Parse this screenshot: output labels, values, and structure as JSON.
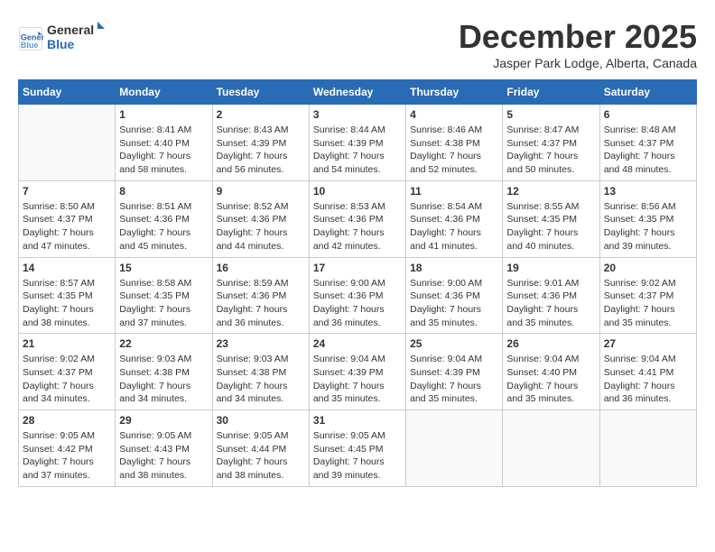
{
  "header": {
    "logo_line1": "General",
    "logo_line2": "Blue",
    "month_title": "December 2025",
    "location": "Jasper Park Lodge, Alberta, Canada"
  },
  "days_of_week": [
    "Sunday",
    "Monday",
    "Tuesday",
    "Wednesday",
    "Thursday",
    "Friday",
    "Saturday"
  ],
  "weeks": [
    [
      {
        "day": "",
        "info": ""
      },
      {
        "day": "1",
        "info": "Sunrise: 8:41 AM\nSunset: 4:40 PM\nDaylight: 7 hours\nand 58 minutes."
      },
      {
        "day": "2",
        "info": "Sunrise: 8:43 AM\nSunset: 4:39 PM\nDaylight: 7 hours\nand 56 minutes."
      },
      {
        "day": "3",
        "info": "Sunrise: 8:44 AM\nSunset: 4:39 PM\nDaylight: 7 hours\nand 54 minutes."
      },
      {
        "day": "4",
        "info": "Sunrise: 8:46 AM\nSunset: 4:38 PM\nDaylight: 7 hours\nand 52 minutes."
      },
      {
        "day": "5",
        "info": "Sunrise: 8:47 AM\nSunset: 4:37 PM\nDaylight: 7 hours\nand 50 minutes."
      },
      {
        "day": "6",
        "info": "Sunrise: 8:48 AM\nSunset: 4:37 PM\nDaylight: 7 hours\nand 48 minutes."
      }
    ],
    [
      {
        "day": "7",
        "info": "Sunrise: 8:50 AM\nSunset: 4:37 PM\nDaylight: 7 hours\nand 47 minutes."
      },
      {
        "day": "8",
        "info": "Sunrise: 8:51 AM\nSunset: 4:36 PM\nDaylight: 7 hours\nand 45 minutes."
      },
      {
        "day": "9",
        "info": "Sunrise: 8:52 AM\nSunset: 4:36 PM\nDaylight: 7 hours\nand 44 minutes."
      },
      {
        "day": "10",
        "info": "Sunrise: 8:53 AM\nSunset: 4:36 PM\nDaylight: 7 hours\nand 42 minutes."
      },
      {
        "day": "11",
        "info": "Sunrise: 8:54 AM\nSunset: 4:36 PM\nDaylight: 7 hours\nand 41 minutes."
      },
      {
        "day": "12",
        "info": "Sunrise: 8:55 AM\nSunset: 4:35 PM\nDaylight: 7 hours\nand 40 minutes."
      },
      {
        "day": "13",
        "info": "Sunrise: 8:56 AM\nSunset: 4:35 PM\nDaylight: 7 hours\nand 39 minutes."
      }
    ],
    [
      {
        "day": "14",
        "info": "Sunrise: 8:57 AM\nSunset: 4:35 PM\nDaylight: 7 hours\nand 38 minutes."
      },
      {
        "day": "15",
        "info": "Sunrise: 8:58 AM\nSunset: 4:35 PM\nDaylight: 7 hours\nand 37 minutes."
      },
      {
        "day": "16",
        "info": "Sunrise: 8:59 AM\nSunset: 4:36 PM\nDaylight: 7 hours\nand 36 minutes."
      },
      {
        "day": "17",
        "info": "Sunrise: 9:00 AM\nSunset: 4:36 PM\nDaylight: 7 hours\nand 36 minutes."
      },
      {
        "day": "18",
        "info": "Sunrise: 9:00 AM\nSunset: 4:36 PM\nDaylight: 7 hours\nand 35 minutes."
      },
      {
        "day": "19",
        "info": "Sunrise: 9:01 AM\nSunset: 4:36 PM\nDaylight: 7 hours\nand 35 minutes."
      },
      {
        "day": "20",
        "info": "Sunrise: 9:02 AM\nSunset: 4:37 PM\nDaylight: 7 hours\nand 35 minutes."
      }
    ],
    [
      {
        "day": "21",
        "info": "Sunrise: 9:02 AM\nSunset: 4:37 PM\nDaylight: 7 hours\nand 34 minutes."
      },
      {
        "day": "22",
        "info": "Sunrise: 9:03 AM\nSunset: 4:38 PM\nDaylight: 7 hours\nand 34 minutes."
      },
      {
        "day": "23",
        "info": "Sunrise: 9:03 AM\nSunset: 4:38 PM\nDaylight: 7 hours\nand 34 minutes."
      },
      {
        "day": "24",
        "info": "Sunrise: 9:04 AM\nSunset: 4:39 PM\nDaylight: 7 hours\nand 35 minutes."
      },
      {
        "day": "25",
        "info": "Sunrise: 9:04 AM\nSunset: 4:39 PM\nDaylight: 7 hours\nand 35 minutes."
      },
      {
        "day": "26",
        "info": "Sunrise: 9:04 AM\nSunset: 4:40 PM\nDaylight: 7 hours\nand 35 minutes."
      },
      {
        "day": "27",
        "info": "Sunrise: 9:04 AM\nSunset: 4:41 PM\nDaylight: 7 hours\nand 36 minutes."
      }
    ],
    [
      {
        "day": "28",
        "info": "Sunrise: 9:05 AM\nSunset: 4:42 PM\nDaylight: 7 hours\nand 37 minutes."
      },
      {
        "day": "29",
        "info": "Sunrise: 9:05 AM\nSunset: 4:43 PM\nDaylight: 7 hours\nand 38 minutes."
      },
      {
        "day": "30",
        "info": "Sunrise: 9:05 AM\nSunset: 4:44 PM\nDaylight: 7 hours\nand 38 minutes."
      },
      {
        "day": "31",
        "info": "Sunrise: 9:05 AM\nSunset: 4:45 PM\nDaylight: 7 hours\nand 39 minutes."
      },
      {
        "day": "",
        "info": ""
      },
      {
        "day": "",
        "info": ""
      },
      {
        "day": "",
        "info": ""
      }
    ]
  ]
}
